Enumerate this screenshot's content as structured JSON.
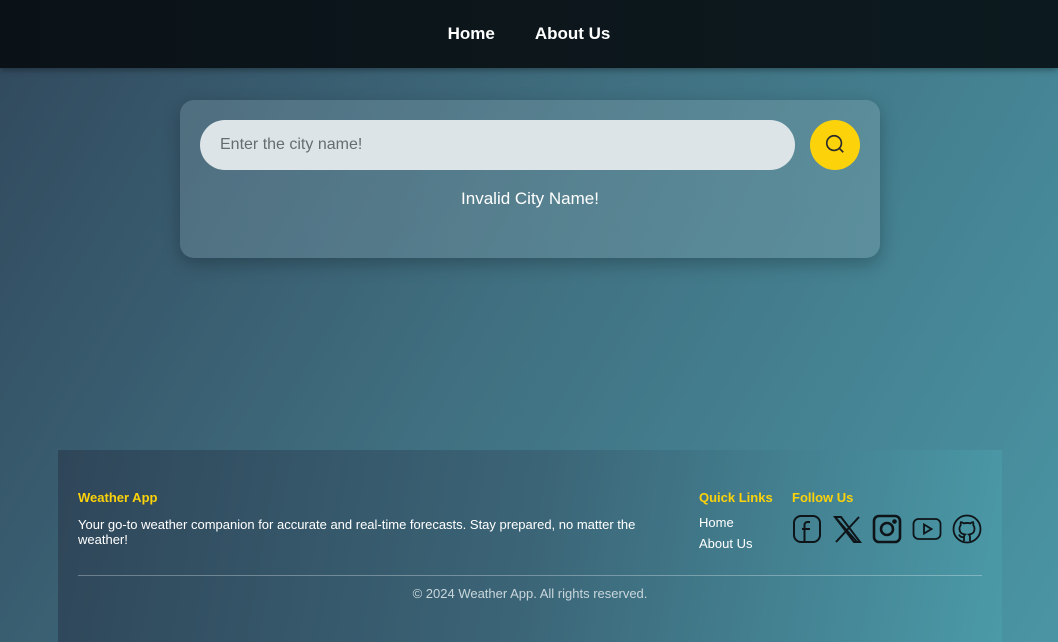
{
  "nav": {
    "home": "Home",
    "about": "About Us"
  },
  "search": {
    "placeholder": "Enter the city name!",
    "value": "",
    "button_icon": "search-icon",
    "error": "Invalid City Name!"
  },
  "footer": {
    "brand": "Weather App",
    "description": "Your go-to weather companion for accurate and real-time forecasts. Stay prepared, no matter the weather!",
    "quick_links_title": "Quick Links",
    "quick_links": [
      "Home",
      "About Us"
    ],
    "follow_title": "Follow Us",
    "socials": [
      "facebook-icon",
      "x-icon",
      "instagram-icon",
      "youtube-icon",
      "github-icon"
    ],
    "copyright": "© 2024 Weather App. All rights reserved."
  },
  "colors": {
    "accent": "#fcd20a",
    "nav_bg": "#0b1217"
  }
}
